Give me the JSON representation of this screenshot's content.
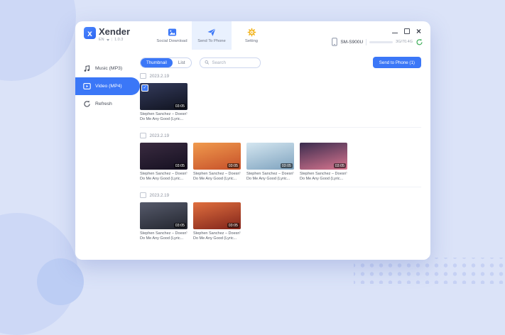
{
  "theme": {
    "page_background": "#dbe3f8",
    "accent_blue": "#3b77f7",
    "active_tab_background": "#e9f1fe",
    "setting_gear_yellow": "#f2b31c",
    "progress_pink": "#f23b6d",
    "device_sync_green": "#3fae5a"
  },
  "icons": {
    "check": "✓",
    "close": "×"
  },
  "window": {
    "brand": {
      "logo_letter": "x",
      "name": "Xender",
      "language": "EN",
      "version": "1.0.3"
    },
    "tabs": [
      {
        "id": "social-download",
        "label": "Social Download",
        "active": false
      },
      {
        "id": "send-to-phone",
        "label": "Send To Phone",
        "active": true
      },
      {
        "id": "setting",
        "label": "Setting",
        "active": false
      }
    ],
    "device": {
      "name": "SM-S900U",
      "storage": "3G/70.4G"
    }
  },
  "sidebar": {
    "items": [
      {
        "id": "music",
        "label": "Music (MP3)",
        "active": false
      },
      {
        "id": "video",
        "label": "Video (MP4)",
        "active": true
      },
      {
        "id": "refresh",
        "label": "Refresh",
        "active": false
      }
    ]
  },
  "toolbar": {
    "thumbnail_label": "Thumbnail",
    "list_label": "List",
    "search_placeholder": "Search",
    "send_button_label": "Send to Phone (1)"
  },
  "content": {
    "sections": [
      {
        "date": "2023.2.19",
        "videos": [
          {
            "title_line1": "Stephen Sanchez – Doesn't",
            "title_line2": "Do Me Any Good (Lyric...",
            "duration": "03:05",
            "selected": true,
            "thumb_colors": [
              "#343b5c",
              "#10131f"
            ]
          }
        ]
      },
      {
        "date": "2023.2.19",
        "videos": [
          {
            "title_line1": "Stephen Sanchez – Doesn't",
            "title_line2": "Do Me Any Good (Lyric...",
            "duration": "03:05",
            "selected": false,
            "thumb_colors": [
              "#3a2b40",
              "#151021"
            ]
          },
          {
            "title_line1": "Stephen Sanchez – Doesn't",
            "title_line2": "Do Me Any Good (Lyric...",
            "duration": "03:05",
            "selected": false,
            "thumb_colors": [
              "#f09a4d",
              "#c6502a"
            ]
          },
          {
            "title_line1": "Stephen Sanchez – Doesn't",
            "title_line2": "Do Me Any Good (Lyric...",
            "duration": "03:05",
            "selected": false,
            "thumb_colors": [
              "#d4e6f0",
              "#7fa3bf"
            ]
          },
          {
            "title_line1": "Stephen Sanchez – Doesn't",
            "title_line2": "Do Me Any Good (Lyric...",
            "duration": "03:05",
            "selected": false,
            "thumb_colors": [
              "#3a2c4e",
              "#d9758f"
            ]
          }
        ]
      },
      {
        "date": "2023.2.19",
        "videos": [
          {
            "title_line1": "Stephen Sanchez – Doesn't",
            "title_line2": "Do Me Any Good (Lyric...",
            "duration": "03:05",
            "selected": false,
            "thumb_colors": [
              "#565a6b",
              "#23262f"
            ]
          },
          {
            "title_line1": "Stephen Sanchez – Doesn't",
            "title_line2": "Do Me Any Good (Lyric...",
            "duration": "03:05",
            "selected": false,
            "thumb_colors": [
              "#e06f3e",
              "#81241b"
            ]
          }
        ]
      }
    ]
  }
}
